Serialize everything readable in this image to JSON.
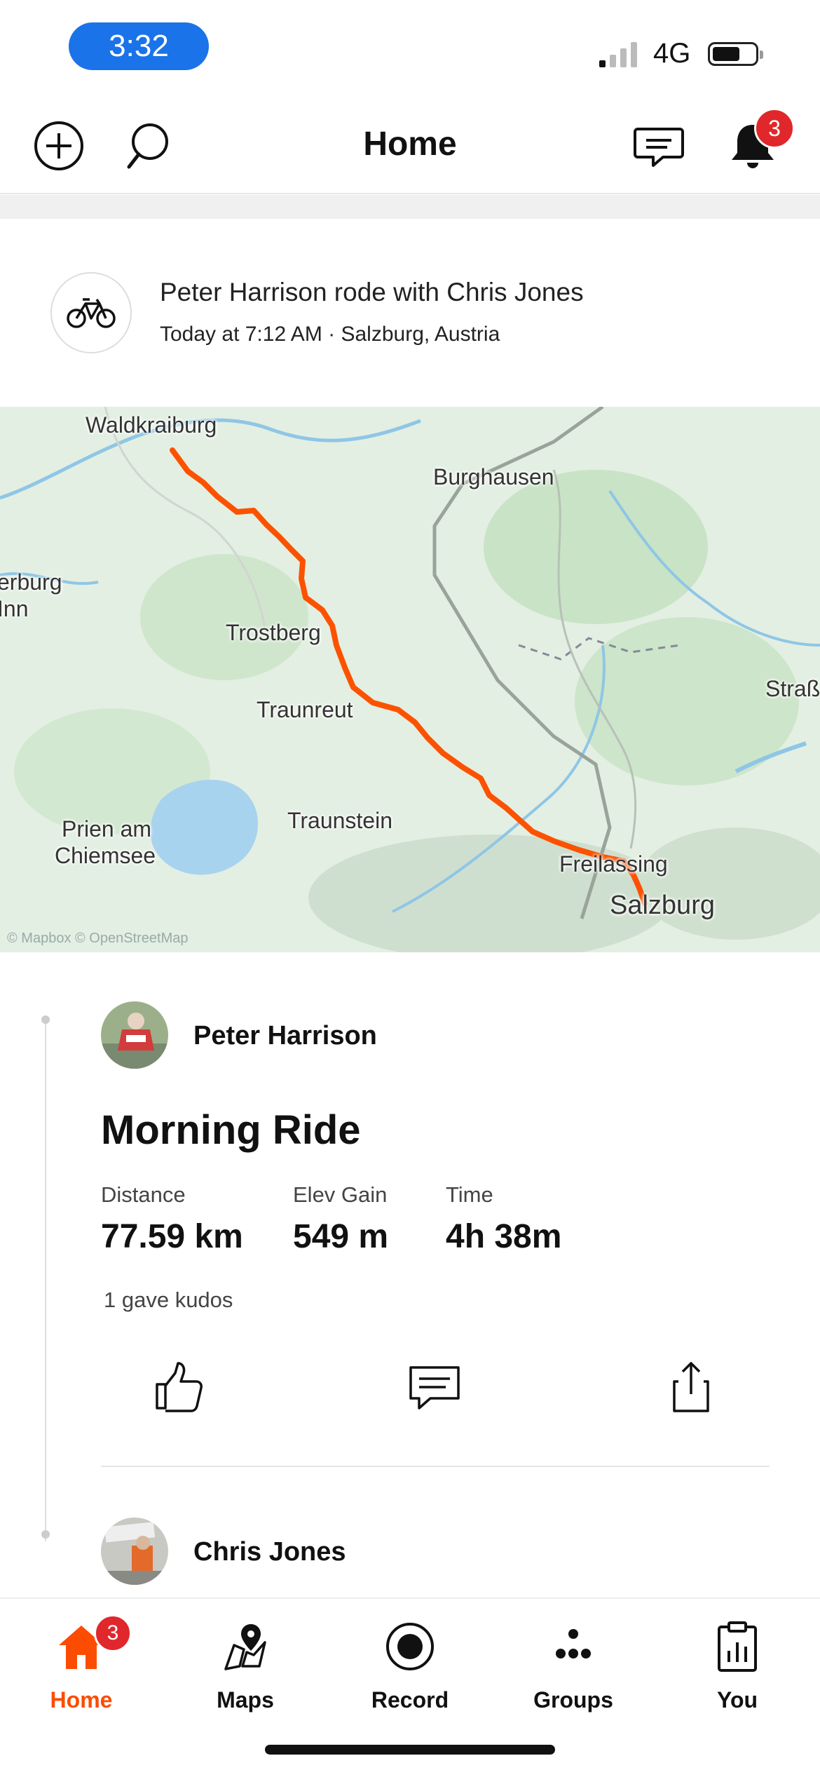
{
  "status": {
    "time": "3:32",
    "network": "4G"
  },
  "header": {
    "title": "Home",
    "notification_count": "3"
  },
  "activity": {
    "headline": "Peter Harrison rode with Chris Jones",
    "subline": "Today at 7:12 AM · Salzburg, Austria",
    "map": {
      "labels": [
        "Waldkraiburg",
        "Burghausen",
        "erburg",
        "Inn",
        "Trostberg",
        "Traunreut",
        "Straß",
        "Prien am",
        "Chiemsee",
        "Traunstein",
        "Freilassing",
        "Salzburg"
      ],
      "attribution": "© Mapbox © OpenStreetMap",
      "route_color": "#fc5200"
    },
    "athlete_1": "Peter Harrison",
    "ride_title": "Morning Ride",
    "stats": [
      {
        "label": "Distance",
        "value": "77.59 km"
      },
      {
        "label": "Elev Gain",
        "value": "549 m"
      },
      {
        "label": "Time",
        "value": "4h 38m"
      }
    ],
    "kudos": "1 gave kudos",
    "athlete_2": "Chris Jones"
  },
  "tabs": [
    {
      "label": "Home",
      "icon": "home-icon",
      "badge": "3"
    },
    {
      "label": "Maps",
      "icon": "map-pin-icon"
    },
    {
      "label": "Record",
      "icon": "record-icon"
    },
    {
      "label": "Groups",
      "icon": "groups-icon"
    },
    {
      "label": "You",
      "icon": "clipboard-chart-icon"
    }
  ],
  "colors": {
    "accent": "#fc4c02",
    "badge": "#e0272b",
    "status_pill": "#1a73e8"
  }
}
